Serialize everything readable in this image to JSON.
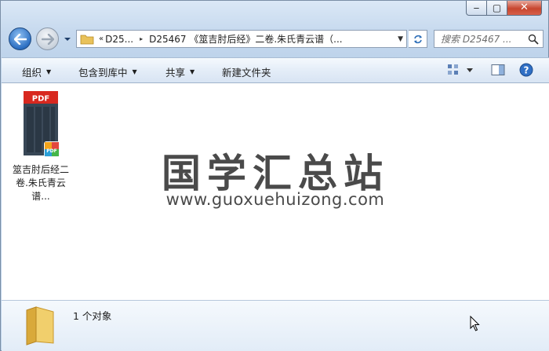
{
  "window": {
    "minimize_glyph": "‒",
    "maximize_glyph": "▢",
    "close_glyph": "✕"
  },
  "nav": {
    "back_icon": "back-arrow-icon",
    "forward_icon": "forward-arrow-icon"
  },
  "address": {
    "overflow": "«",
    "crumb1": "D25...",
    "separator": "▸",
    "crumb2": "D25467 《筮吉肘后经》二卷.朱氏青云谱（..."
  },
  "search": {
    "placeholder": "搜索 D25467 ..."
  },
  "toolbar": {
    "organize": "组织",
    "include_in_library": "包含到库中",
    "share": "共享",
    "new_folder": "新建文件夹"
  },
  "file": {
    "badge": "PDF",
    "name_line1": "筮吉肘后经二",
    "name_line2": "卷.朱氏青云谱..."
  },
  "watermark": {
    "title": "国学汇总站",
    "url": "www.guoxuehuizong.com"
  },
  "status": {
    "count": "1 个对象"
  },
  "colors": {
    "accent": "#2c6fc2",
    "pdf_red": "#d8281f",
    "close_red": "#c7462f",
    "folder_yellow": "#e9c25a"
  }
}
